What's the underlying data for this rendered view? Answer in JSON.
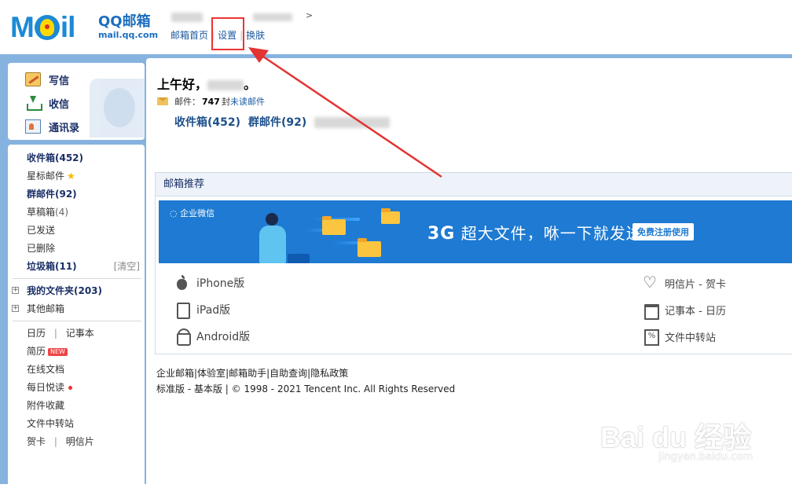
{
  "header": {
    "logo_word": "Mail",
    "logo_title": "QQ邮箱",
    "logo_domain": "mail.qq.com",
    "user_suffix": "ı ₽ıł >",
    "links": [
      "邮箱首页",
      "设置",
      "换肤"
    ],
    "separator": "|"
  },
  "sidebar": {
    "tools": [
      {
        "label": "写信",
        "icon": "write-icon"
      },
      {
        "label": "收信",
        "icon": "inbox-download-icon"
      },
      {
        "label": "通讯录",
        "icon": "contacts-card-icon"
      }
    ],
    "folders": [
      {
        "label": "收件箱(452)"
      },
      {
        "label": "星标邮件"
      },
      {
        "label": "群邮件(92)"
      },
      {
        "label": "草稿箱",
        "count": "(4)"
      },
      {
        "label": "已发送"
      },
      {
        "label": "已删除"
      },
      {
        "label": "垃圾箱(11)",
        "action": "[清空]"
      }
    ],
    "groups": [
      {
        "label": "我的文件夹(203)"
      },
      {
        "label": "其他邮箱"
      }
    ],
    "extras": {
      "calendar": "日历",
      "notes": "记事本",
      "resume": "简历",
      "new_badge": "NEW",
      "online_docs": "在线文档",
      "daily_read": "每日悦读",
      "attachments": "附件收藏",
      "file_transfer": "文件中转站",
      "greeting_card": "贺卡",
      "postcard": "明信片",
      "sep": "|"
    }
  },
  "main": {
    "greeting": "上午好，",
    "greeting_end": "。",
    "mail_label": "邮件：",
    "mail_count": "747",
    "mail_unit": "封",
    "unread_link": "未读邮件",
    "box_links": [
      "收件箱(452)",
      "群邮件(92)"
    ],
    "recommend": {
      "title": "邮箱推荐",
      "banner_brand": "企业微信",
      "banner_slogan_big": "3G",
      "banner_slogan": " 超大文件，咻一下就发送",
      "banner_cta": "免费注册使用"
    },
    "apps_left": [
      {
        "label": "iPhone版",
        "icon": "apple-icon"
      },
      {
        "label": "iPad版",
        "icon": "ipad-icon"
      },
      {
        "label": "Android版",
        "icon": "android-icon"
      }
    ],
    "apps_right": [
      {
        "label": "明信片 - 贺卡",
        "icon": "heart-icon"
      },
      {
        "label": "记事本 - 日历",
        "icon": "calendar-icon"
      },
      {
        "label": "文件中转站",
        "icon": "file-transfer-icon"
      }
    ],
    "footer_links": [
      "企业邮箱",
      "|体验室",
      "|邮箱助手",
      "|自助查询",
      "|隐私政策"
    ],
    "footer_version": "标准版 - 基本版 | © 1998 - 2021 Tencent Inc. All Rights Reserved"
  },
  "watermark": {
    "text": "Bai du 经验",
    "sub": "jingyan.baidu.com"
  },
  "colors": {
    "frame": "#86b2e0",
    "brand": "#1b8ad6",
    "highlight": "#e33333",
    "banner": "#1e7ad2"
  }
}
